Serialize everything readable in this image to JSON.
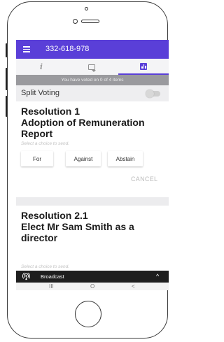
{
  "app_bar": {
    "title": "332-618-978",
    "menu_icon": "menu-icon"
  },
  "tabs": [
    {
      "icon": "info-icon",
      "glyph": "i",
      "active": false
    },
    {
      "icon": "chat-icon",
      "active": false
    },
    {
      "icon": "bar-chart-icon",
      "active": true
    }
  ],
  "voted_status": "You have voted on 0 of 4 items",
  "split_voting": {
    "label": "Split Voting",
    "enabled": false
  },
  "resolutions": [
    {
      "title_lines": [
        "Resolution 1",
        "Adoption of Remuneration",
        "Report"
      ],
      "hint": "Select a choice to send.",
      "choices": [
        "For",
        "Against",
        "Abstain"
      ],
      "cancel_label": "CANCEL"
    },
    {
      "title_lines": [
        "Resolution 2.1",
        "Elect Mr Sam Smith as a",
        "director"
      ],
      "hint": "Select a choice to send."
    }
  ],
  "broadcast": {
    "label": "Broadcast",
    "icon": "broadcast-icon",
    "toggle_icon": "chevron-up-icon",
    "chevron": "^"
  },
  "android_nav": {
    "recents": "III",
    "home": "O",
    "back": "<"
  },
  "colors": {
    "accent": "#5a3fd8",
    "status_strip": "#9a9a9e",
    "broadcast_bar": "#1e1e1e"
  }
}
